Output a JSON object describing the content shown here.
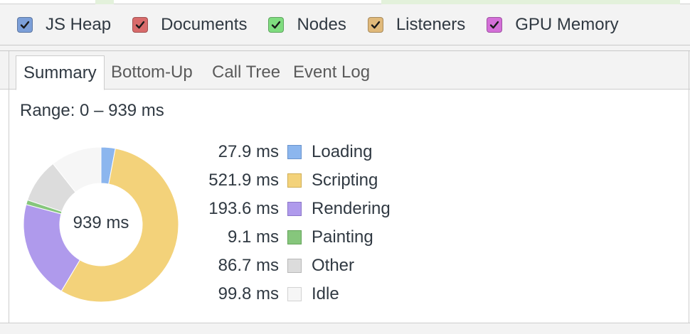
{
  "counters": [
    {
      "label": "JS Heap",
      "color": "#7c9fd8",
      "checked": true
    },
    {
      "label": "Documents",
      "color": "#d86b6b",
      "checked": true
    },
    {
      "label": "Nodes",
      "color": "#7fdc7f",
      "checked": true
    },
    {
      "label": "Listeners",
      "color": "#e0b97a",
      "checked": true
    },
    {
      "label": "GPU Memory",
      "color": "#d46fd8",
      "checked": true
    }
  ],
  "tabs": [
    {
      "label": "Summary",
      "selected": true
    },
    {
      "label": "Bottom-Up",
      "selected": false
    },
    {
      "label": "Call Tree",
      "selected": false
    },
    {
      "label": "Event Log",
      "selected": false
    }
  ],
  "summary": {
    "range_text": "Range: 0 – 939 ms",
    "total_text": "939 ms",
    "categories": [
      {
        "value": 27.9,
        "value_text": "27.9 ms",
        "name": "Loading",
        "color": "#8cb6ee",
        "border": "#6a94cc"
      },
      {
        "value": 521.9,
        "value_text": "521.9 ms",
        "name": "Scripting",
        "color": "#f3d27a",
        "border": "#cfae56"
      },
      {
        "value": 193.6,
        "value_text": "193.6 ms",
        "name": "Rendering",
        "color": "#af9aec",
        "border": "#8b76c8"
      },
      {
        "value": 9.1,
        "value_text": "9.1 ms",
        "name": "Painting",
        "color": "#86c67c",
        "border": "#64a45a"
      },
      {
        "value": 86.7,
        "value_text": "86.7 ms",
        "name": "Other",
        "color": "#dcdcdc",
        "border": "#b8b8b8"
      },
      {
        "value": 99.8,
        "value_text": "99.8 ms",
        "name": "Idle",
        "color": "#f6f6f6",
        "border": "#d2d2d2"
      }
    ]
  }
}
